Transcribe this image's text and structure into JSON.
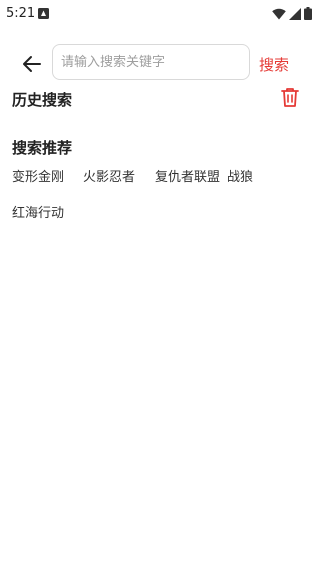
{
  "status_bar": {
    "time": "5:21",
    "icons": [
      "notification-icon",
      "wifi-icon",
      "cell-signal-icon",
      "battery-icon"
    ]
  },
  "search": {
    "placeholder": "请输入搜索关键字",
    "value": "",
    "button_label": "搜索",
    "back_icon": "arrow-left-icon"
  },
  "history": {
    "title": "历史搜索",
    "clear_icon": "trash-icon",
    "items": []
  },
  "recommend": {
    "title": "搜索推荐",
    "items": [
      "变形金刚",
      "火影忍者",
      "复仇者联盟",
      "战狼",
      "红海行动"
    ]
  },
  "colors": {
    "accent": "#e53935",
    "text": "#222222",
    "placeholder": "#9e9e9e",
    "border": "#d9d9d9",
    "background": "#ffffff"
  }
}
